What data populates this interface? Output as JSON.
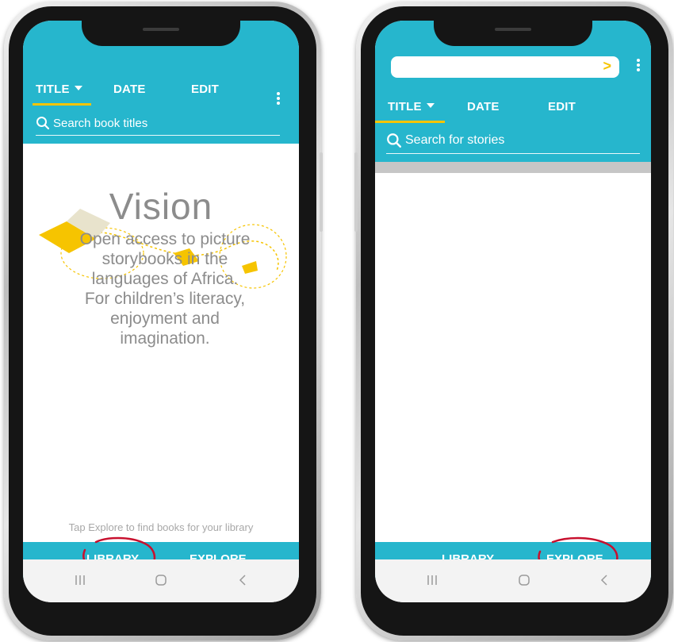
{
  "left_screen": {
    "tabs": [
      {
        "label": "TITLE"
      },
      {
        "label": "DATE"
      },
      {
        "label": "EDIT"
      }
    ],
    "search_placeholder": "Search book titles",
    "vision_title": "Vision",
    "vision_lines": [
      "Open access to picture",
      "storybooks in the",
      "languages of Africa.",
      "For children’s literacy,",
      "enjoyment and",
      "imagination."
    ],
    "hint": "Tap Explore to find books for your library",
    "bottom_tabs": [
      {
        "label": "LIBRARY",
        "active": true
      },
      {
        "label": "EXPLORE",
        "active": false
      }
    ]
  },
  "right_screen": {
    "url_value": "",
    "url_go_glyph": ">",
    "tabs": [
      {
        "label": "TITLE"
      },
      {
        "label": "DATE"
      },
      {
        "label": "EDIT"
      }
    ],
    "search_placeholder": "Search for stories",
    "bottom_tabs": [
      {
        "label": "LIBRARY",
        "active": false
      },
      {
        "label": "EXPLORE",
        "active": true
      }
    ]
  },
  "icons": {
    "search": "search-icon",
    "more": "more-vert-icon",
    "sort": "caret-down-icon",
    "nav_recent": "recent-apps-icon",
    "nav_home": "home-icon",
    "nav_back": "back-icon"
  },
  "colors": {
    "app_bar": "#26b6cd",
    "accent": "#f6c400",
    "highlight_circle": "#c8102e",
    "text_muted": "#8c8c8c"
  }
}
